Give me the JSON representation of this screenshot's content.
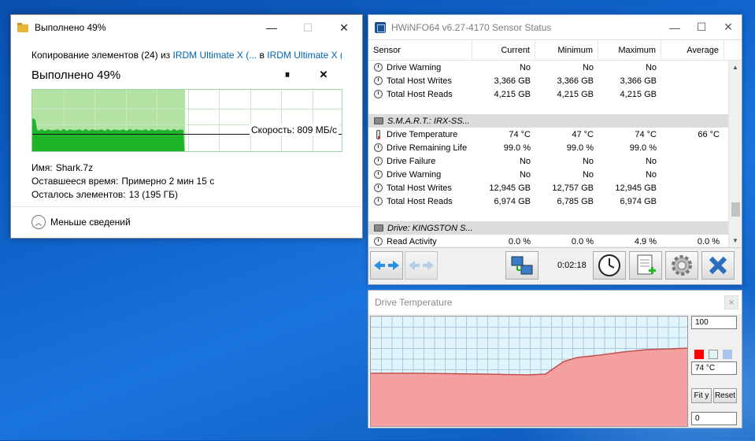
{
  "copy_dialog": {
    "title": "Выполнено 49%",
    "line_prefix": "Копирование элементов (24) из ",
    "source": "IRDM Ultimate X (...",
    "between": " в ",
    "dest": "IRDM Ultimate X (...",
    "heading": "Выполнено 49%",
    "pause_symbol": "⏸",
    "close_symbol": "✕",
    "progress_fraction": 0.49,
    "speed_label": "Скорость: 809 МБ/с",
    "name_label": "Имя:",
    "name_value": "Shark.7z",
    "time_label": "Оставшееся время:",
    "time_value": "Примерно 2 мин 15 с",
    "items_label": "Осталось элементов:",
    "items_value": "13 (195 ГБ)",
    "less_details": "Меньше сведений",
    "minimize": "—",
    "maximize": "☐",
    "close": "✕"
  },
  "hwinfo": {
    "title": "HWiNFO64 v6.27-4170 Sensor Status",
    "minimize": "—",
    "maximize": "☐",
    "close": "✕",
    "columns": [
      "Sensor",
      "Current",
      "Minimum",
      "Maximum",
      "Average"
    ],
    "rows": [
      {
        "type": "sensor",
        "icon": "circle",
        "name": "Drive Warning",
        "cur": "No",
        "min": "No",
        "max": "No",
        "avg": ""
      },
      {
        "type": "sensor",
        "icon": "circle",
        "name": "Total Host Writes",
        "cur": "3,366 GB",
        "min": "3,366 GB",
        "max": "3,366 GB",
        "avg": ""
      },
      {
        "type": "sensor",
        "icon": "circle",
        "name": "Total Host Reads",
        "cur": "4,215 GB",
        "min": "4,215 GB",
        "max": "4,215 GB",
        "avg": ""
      },
      {
        "type": "blank",
        "name": "",
        "cur": "",
        "min": "",
        "max": "",
        "avg": ""
      },
      {
        "type": "group",
        "icon": "drive",
        "name": "S.M.A.R.T.: IRX-SS...",
        "cur": "",
        "min": "",
        "max": "",
        "avg": ""
      },
      {
        "type": "sensor",
        "icon": "therm",
        "name": "Drive Temperature",
        "cur": "74 °C",
        "min": "47 °C",
        "max": "74 °C",
        "avg": "66 °C"
      },
      {
        "type": "sensor",
        "icon": "circle",
        "name": "Drive Remaining Life",
        "cur": "99.0 %",
        "min": "99.0 %",
        "max": "99.0 %",
        "avg": ""
      },
      {
        "type": "sensor",
        "icon": "circle",
        "name": "Drive Failure",
        "cur": "No",
        "min": "No",
        "max": "No",
        "avg": ""
      },
      {
        "type": "sensor",
        "icon": "circle",
        "name": "Drive Warning",
        "cur": "No",
        "min": "No",
        "max": "No",
        "avg": ""
      },
      {
        "type": "sensor",
        "icon": "circle",
        "name": "Total Host Writes",
        "cur": "12,945 GB",
        "min": "12,757 GB",
        "max": "12,945 GB",
        "avg": ""
      },
      {
        "type": "sensor",
        "icon": "circle",
        "name": "Total Host Reads",
        "cur": "6,974 GB",
        "min": "6,785 GB",
        "max": "6,974 GB",
        "avg": ""
      },
      {
        "type": "blank",
        "name": "",
        "cur": "",
        "min": "",
        "max": "",
        "avg": ""
      },
      {
        "type": "group",
        "icon": "drive",
        "name": "Drive: KINGSTON S...",
        "cur": "",
        "min": "",
        "max": "",
        "avg": ""
      },
      {
        "type": "sensor",
        "icon": "circle",
        "name": "Read Activity",
        "cur": "0.0 %",
        "min": "0.0 %",
        "max": "4.9 %",
        "avg": "0.0 %"
      }
    ],
    "elapsed_time": "0:02:18",
    "toolbar_icons": [
      "arrows-left-right-icon",
      "arrows-left-right-disabled-icon",
      "network-icon",
      "clock-icon",
      "report-add-icon",
      "settings-gear-icon",
      "close-x-icon"
    ]
  },
  "temp_graph": {
    "title": "Drive Temperature",
    "max_field": "100",
    "current_field": "74 °C",
    "min_field": "0",
    "fit_label": "Fit y",
    "reset_label": "Reset",
    "colors": {
      "line": "#e00000",
      "bg": "#e2f4fb",
      "grid": "#aac8dd",
      "fill": "#f4a0a0",
      "swatch1": "#ff0000",
      "swatch2": "#dff4f7",
      "swatch3": "#a8c4e8"
    }
  }
}
